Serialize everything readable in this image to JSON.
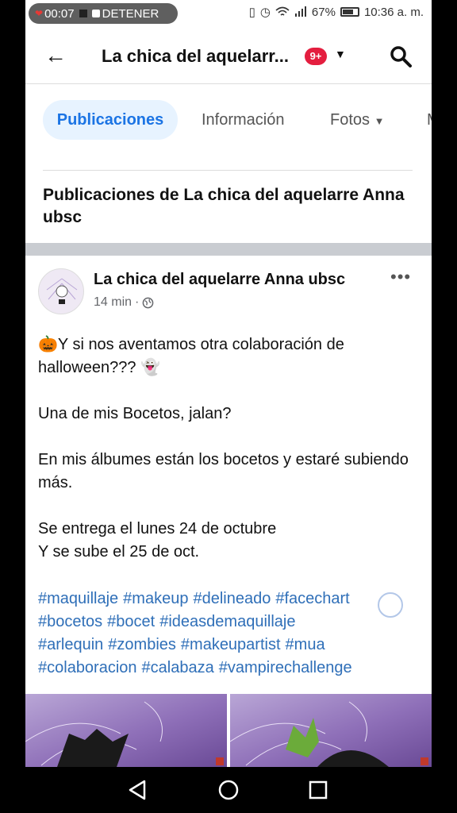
{
  "status_bar": {
    "recording_time": "00:07",
    "recording_action": "DETENER",
    "battery": "67%",
    "time": "10:36 a. m."
  },
  "app_bar": {
    "title": "La chica del aquelarr...",
    "notification_badge": "9+"
  },
  "tabs": [
    {
      "label": "Publicaciones",
      "active": true
    },
    {
      "label": "Información",
      "active": false
    },
    {
      "label": "Fotos",
      "active": false
    },
    {
      "label": "M",
      "active": false
    }
  ],
  "section_title": "Publicaciones de La chica del aquelarre Anna ubsc",
  "post": {
    "author": "La chica del aquelarre Anna ubsc",
    "time": "14 min",
    "separator": "·",
    "paragraphs": [
      "🎃Y si nos aventamos otra colaboración de halloween??? 👻",
      "Una de mis Bocetos, jalan?",
      "En mis álbumes están los bocetos y  estaré subiendo más.",
      "Se entrega el lunes 24 de octubre\nY se sube el 25 de oct."
    ],
    "hashtags": [
      "#maquillaje",
      "#makeup",
      "#delineado",
      "#facechart",
      "#bocetos",
      "#bocet",
      "#ideasdemaquillaje",
      "#arlequin",
      "#zombies",
      "#makeupartist",
      "#mua",
      "#colaboracion",
      "#calabaza",
      "#vampirechallenge"
    ]
  },
  "colors": {
    "accent": "#1b74e4",
    "hashtag": "#2f6fb8",
    "badge": "#e41e3f"
  }
}
